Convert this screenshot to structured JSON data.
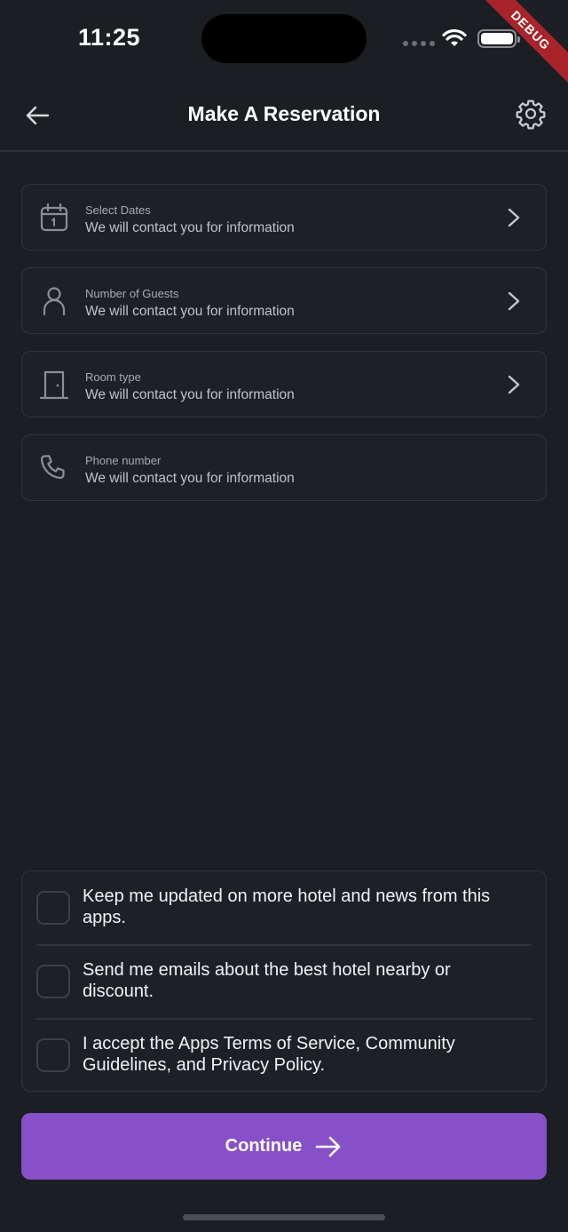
{
  "status_bar": {
    "time": "11:25"
  },
  "debug_banner": "DEBUG",
  "header": {
    "title": "Make A Reservation",
    "back_icon": "arrow-left-icon",
    "settings_icon": "gear-icon"
  },
  "fields": [
    {
      "label": "Select Dates",
      "value": "We will contact you for information",
      "icon": "calendar-icon",
      "chevron": true
    },
    {
      "label": "Number of Guests",
      "value": "We will contact you for information",
      "icon": "person-icon",
      "chevron": true
    },
    {
      "label": "Room type",
      "value": "We will contact you for information",
      "icon": "door-icon",
      "chevron": true
    },
    {
      "label": "Phone number",
      "value": "We will contact you for information",
      "icon": "phone-icon",
      "chevron": false
    }
  ],
  "checkboxes": [
    {
      "text": "Keep me updated on more hotel and news from this apps.",
      "checked": false
    },
    {
      "text": "Send me emails about the best hotel nearby or discount.",
      "checked": false
    },
    {
      "text": "I accept the Apps Terms of Service, Community Guidelines, and Privacy Policy.",
      "checked": false
    }
  ],
  "continue_button": {
    "label": "Continue",
    "icon": "arrow-right-icon"
  },
  "colors": {
    "background": "#1b1f24",
    "accent": "#8750c8",
    "border": "#30353b",
    "debug": "#a8242a"
  }
}
